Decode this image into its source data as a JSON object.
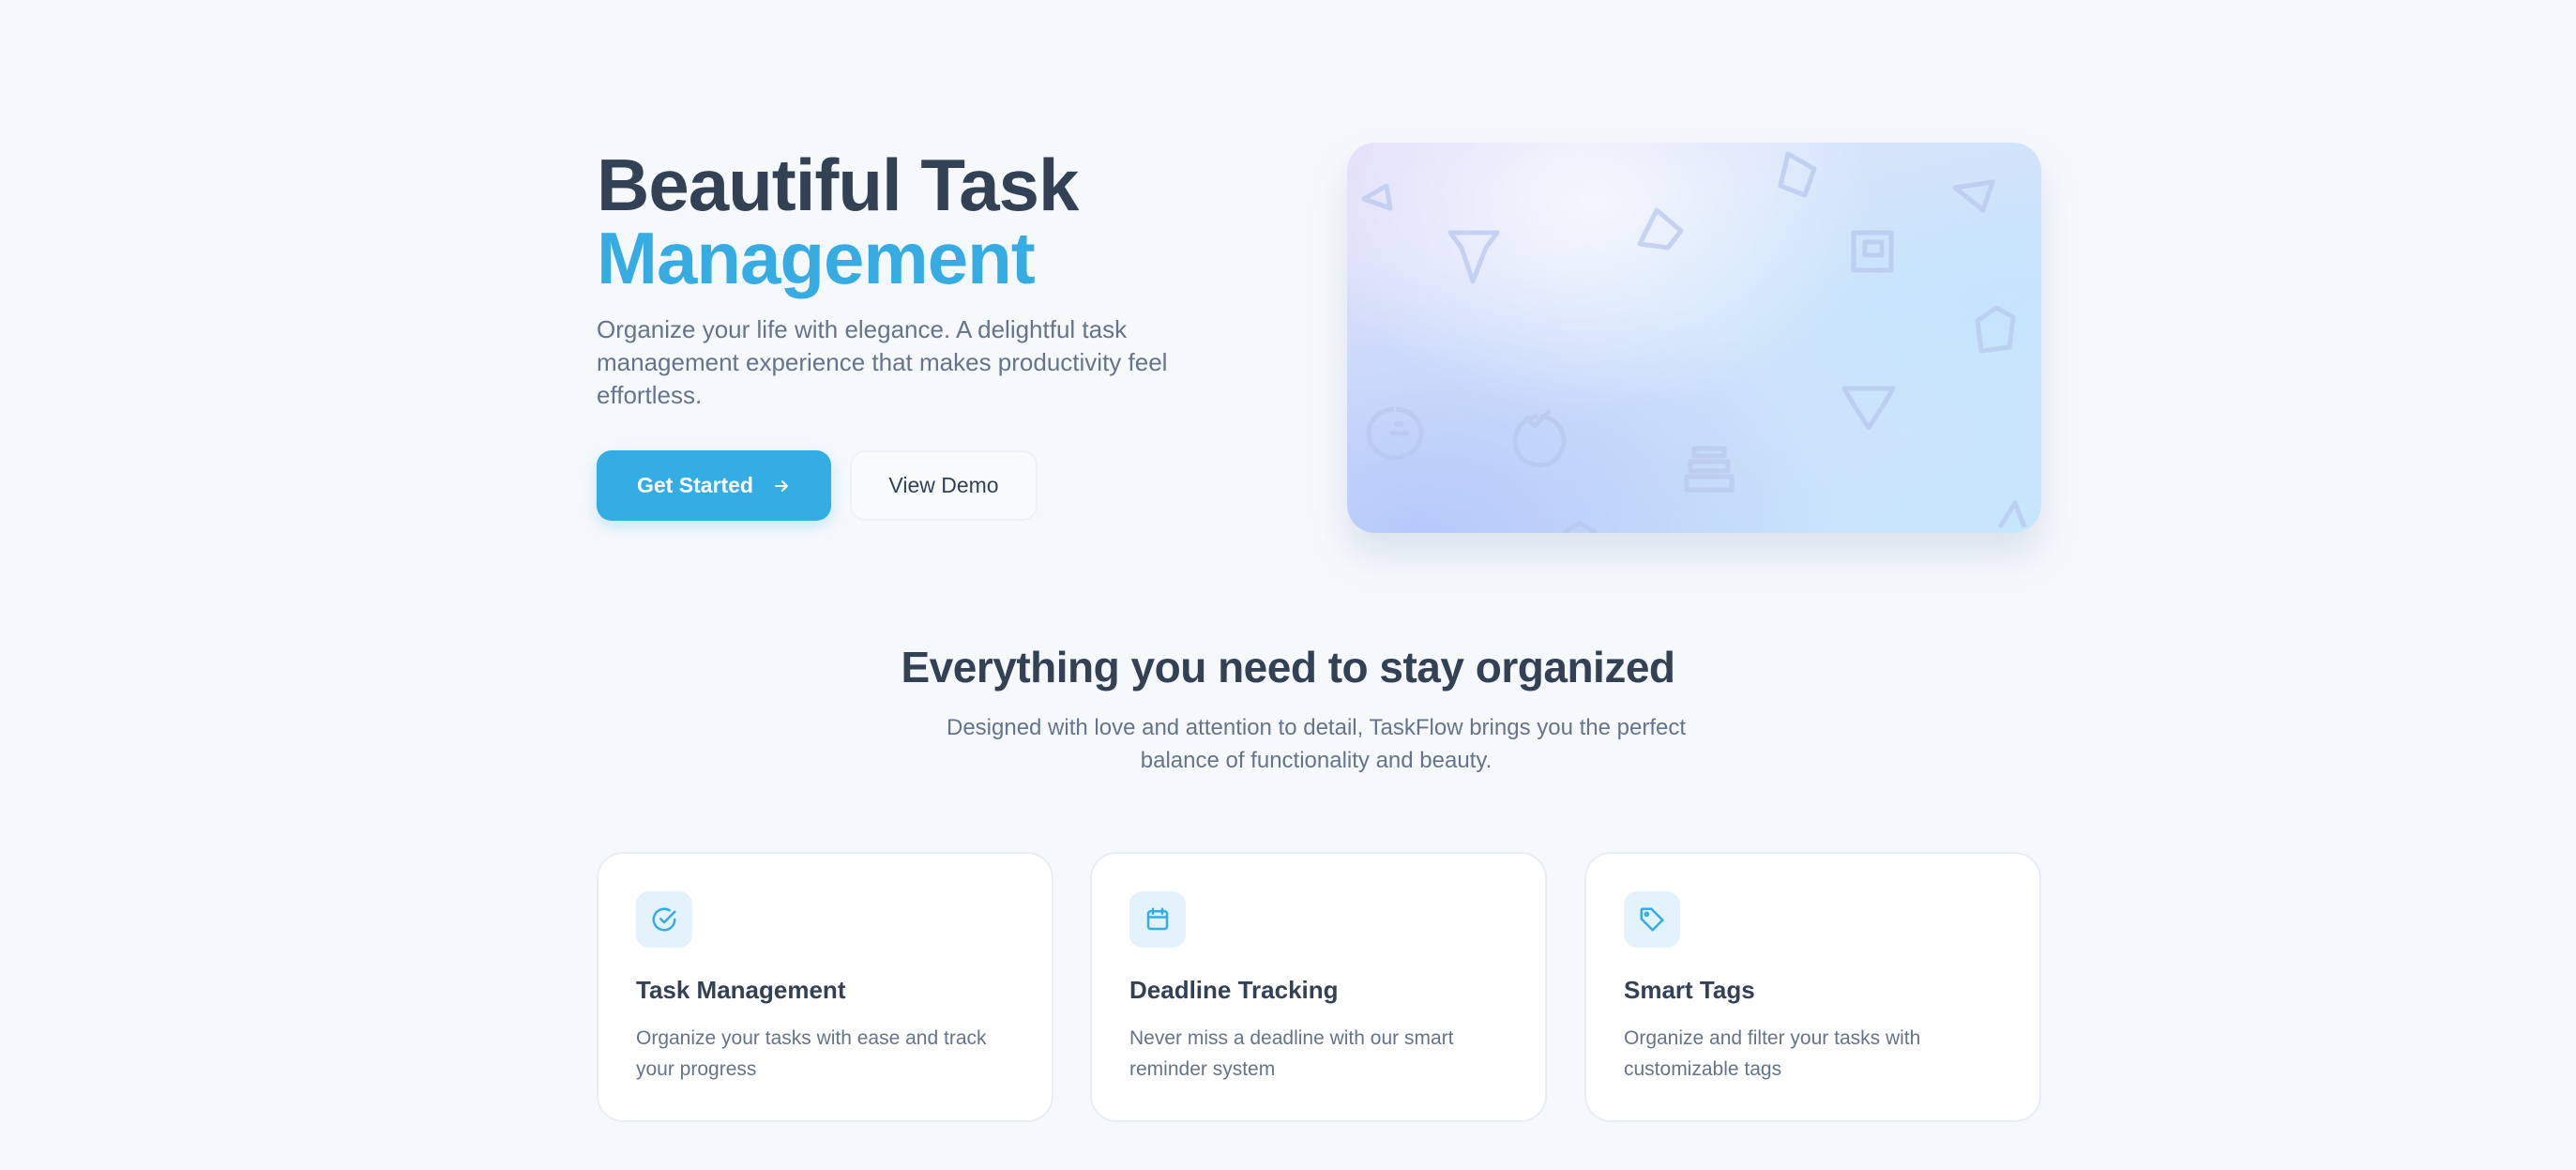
{
  "hero": {
    "title_line1": "Beautiful Task",
    "title_line2": "Management",
    "subtitle": "Organize your life with elegance. A delightful task management experience that makes productivity feel effortless.",
    "primary_button": "Get Started",
    "secondary_button": "View Demo"
  },
  "features": {
    "title": "Everything you need to stay organized",
    "subtitle": "Designed with love and attention to detail, TaskFlow brings you the perfect balance of functionality and beauty.",
    "cards": [
      {
        "icon": "check-circle-icon",
        "title": "Task Management",
        "description": "Organize your tasks with ease and track your progress"
      },
      {
        "icon": "calendar-icon",
        "title": "Deadline Tracking",
        "description": "Never miss a deadline with our smart reminder system"
      },
      {
        "icon": "tag-icon",
        "title": "Smart Tags",
        "description": "Organize and filter your tasks with customizable tags"
      }
    ]
  },
  "colors": {
    "accent": "#33ade3",
    "heading": "#334155",
    "muted": "#64748b",
    "background": "#f6f9fc"
  }
}
